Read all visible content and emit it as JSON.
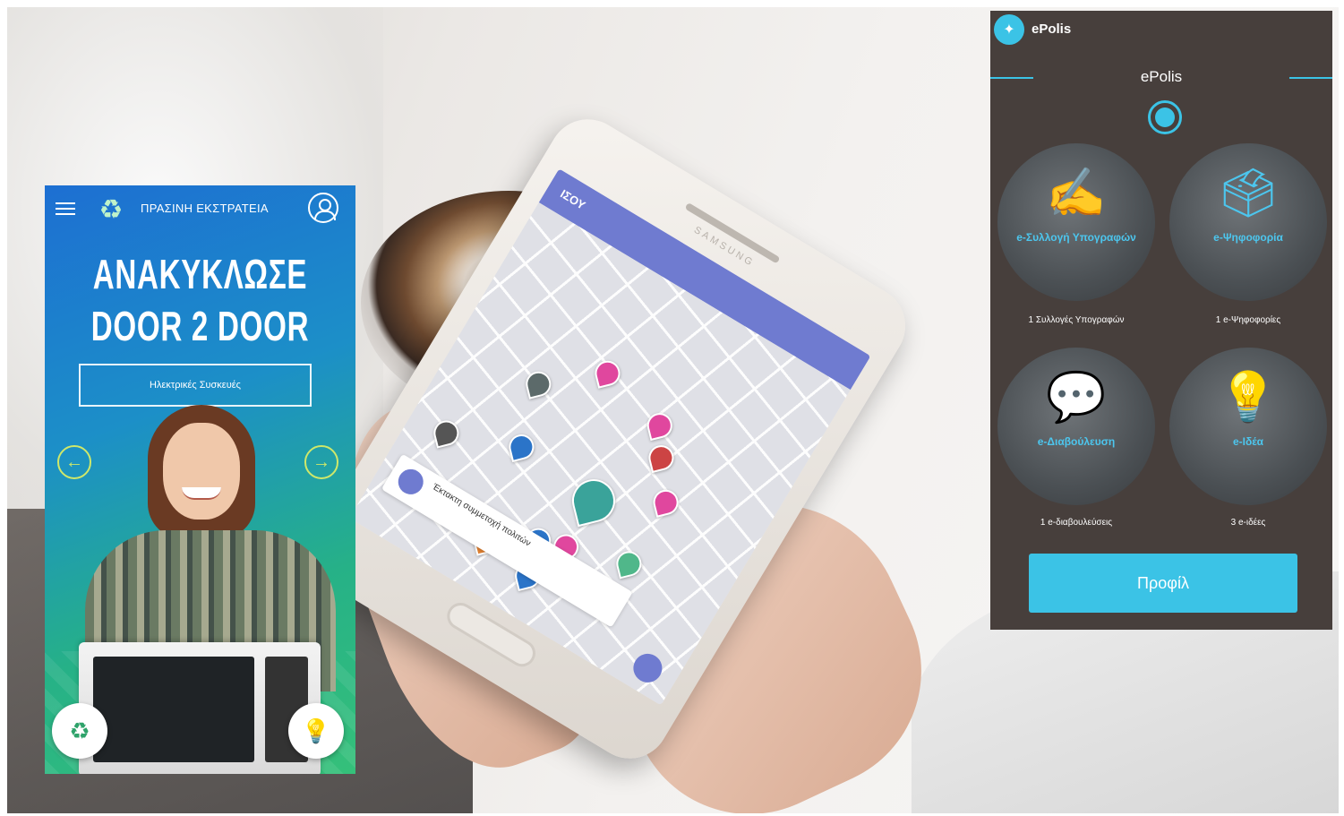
{
  "recycle_app": {
    "brand": "ΠΡΑΣΙΝΗ ΕΚΣΤΡΑΤΕΙΑ",
    "headline_line1": "ΑΝΑΚΥΚΛΩΣΕ",
    "headline_line2": "DOOR 2 DOOR",
    "category_button": "Ηλεκτρικές Συσκευές",
    "icons": {
      "menu": "hamburger-menu-icon",
      "logo": "recycle-icon",
      "profile": "user-icon",
      "prev": "arrow-left-icon",
      "next": "arrow-right-icon",
      "badge_left": "recycle-logo-icon",
      "badge_right": "lightbulb-icon"
    },
    "colors": {
      "gradient_start": "#1d6fd2",
      "gradient_end": "#35c07a",
      "arrow": "#cfe86a"
    }
  },
  "map_app": {
    "title": "ΙΣΟΥ",
    "card_text": "Έκτακτη συμμετοχή πολιτών",
    "pin_colors": [
      "#e0479e",
      "#e0479e",
      "#e0479e",
      "#5c6a6a",
      "#2b74c8",
      "#3aa39a",
      "#50b78a",
      "#555",
      "#cc4444",
      "#2b74c8",
      "#e0479e",
      "#2b74c8",
      "#d4c035",
      "#e08030"
    ]
  },
  "epolis": {
    "app_name": "ePolis",
    "screen_title": "ePolis",
    "tiles": [
      {
        "name": "e-Συλλογή Υπογραφών",
        "icon": "petition-icon",
        "count": "1 Συλλογές Υπογραφών"
      },
      {
        "name": "e-Ψηφοφορία",
        "icon": "ballot-box-icon",
        "count": "1 e-Ψηφοφορίες"
      },
      {
        "name": "e-Διαβούλευση",
        "icon": "consultation-icon",
        "count": "1 e-διαβουλεύσεις"
      },
      {
        "name": "e-Ιδέα",
        "icon": "lightbulb-icon",
        "count": "3 e-ιδέες"
      }
    ],
    "profile_button": "Προφίλ",
    "colors": {
      "background": "#473f3c",
      "accent": "#3bc3e6"
    }
  }
}
